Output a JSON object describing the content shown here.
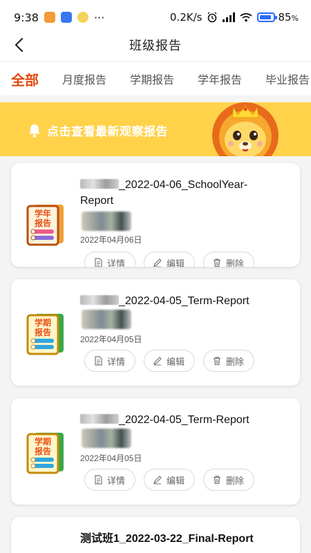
{
  "status_bar": {
    "time": "9:38",
    "dots": "···",
    "network_speed": "0.2K/s",
    "battery_level": "85",
    "battery_unit": "%",
    "battery_fraction": 0.85,
    "icons": [
      "alarm-icon",
      "signal-icon",
      "wifi-icon",
      "battery-icon"
    ]
  },
  "nav": {
    "title": "班级报告",
    "back_icon": "chevron-left-icon"
  },
  "tabs": [
    {
      "label": "全部",
      "active": true
    },
    {
      "label": "月度报告",
      "active": false
    },
    {
      "label": "学期报告",
      "active": false
    },
    {
      "label": "学年报告",
      "active": false
    },
    {
      "label": "毕业报告",
      "active": false
    }
  ],
  "banner": {
    "text": "点击查看最新观察报告",
    "icon": "bell-icon",
    "mascot": "lion-mascot"
  },
  "actions": {
    "detail": "详情",
    "edit": "编辑",
    "delete": "删除"
  },
  "reports": [
    {
      "title_line1": "_2022-04-06_SchoolYear-",
      "title_line2": "Report",
      "date": "2022年04月06日",
      "badge_text_top": "学年",
      "badge_text_bottom": "报告",
      "badge_color": "#f08a24"
    },
    {
      "title_line1": "_2022-04-05_Term-Report",
      "title_line2": "",
      "date": "2022年04月05日",
      "badge_text_top": "学期",
      "badge_text_bottom": "报告",
      "badge_color": "#f5c518"
    },
    {
      "title_line1": "_2022-04-05_Term-Report",
      "title_line2": "",
      "date": "2022年04月05日",
      "badge_text_top": "学期",
      "badge_text_bottom": "报告",
      "badge_color": "#f5c518"
    },
    {
      "title_line1": "测试班1_2022-03-22_Final-Report",
      "title_line2": "",
      "date": "",
      "badge_text_top": "",
      "badge_text_bottom": "",
      "badge_color": ""
    }
  ],
  "colors": {
    "accent": "#e24a12",
    "banner": "#ffd24a",
    "battery": "#2a6bff"
  }
}
